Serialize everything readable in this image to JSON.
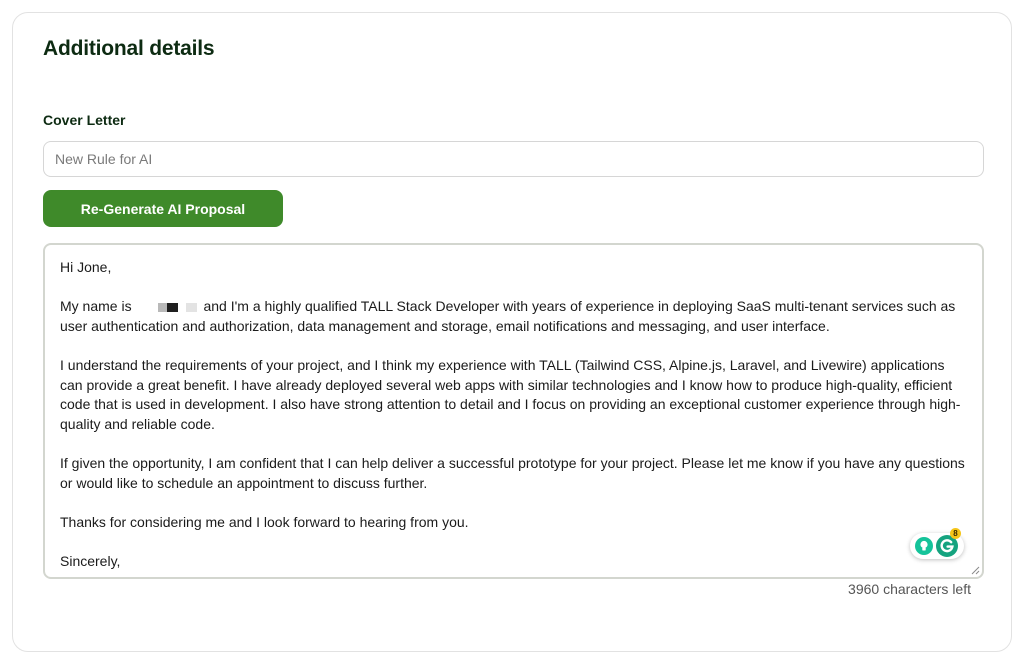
{
  "section": {
    "title": "Additional details"
  },
  "cover_letter": {
    "label": "Cover Letter",
    "rule_input": {
      "value": "",
      "placeholder": "New Rule for AI"
    },
    "regenerate_label": "Re-Generate AI Proposal",
    "letter": {
      "greeting": "Hi Jone,",
      "intro_before": "My name is",
      "intro_after": "and I'm a highly qualified TALL Stack Developer with years of experience in deploying SaaS multi-tenant services such as user authentication and authorization, data management and storage, email notifications and messaging, and user interface.",
      "paragraph2": "I understand the requirements of your project, and I think my experience with TALL (Tailwind CSS, Alpine.js, Laravel, and Livewire) applications can provide a great benefit. I have already deployed several web apps with similar technologies and I know how to produce high-quality, efficient code that is used in development. I also have strong attention to detail and I focus on providing an exceptional customer experience through high-quality and reliable code.",
      "paragraph3": "If given the opportunity, I am confident that I can help deliver a successful prototype for your project. Please let me know if you have any questions or would like to schedule an appointment to discuss further.",
      "paragraph4": "Thanks for considering me and I look forward to hearing from you.",
      "closing": "Sincerely,"
    },
    "grammarly_badge_count": "8",
    "characters_left": "3960 characters left"
  },
  "colors": {
    "primary_green": "#3f8a2a",
    "title_dark_green": "#0d2b12",
    "grammarly_green": "#15c39a"
  }
}
